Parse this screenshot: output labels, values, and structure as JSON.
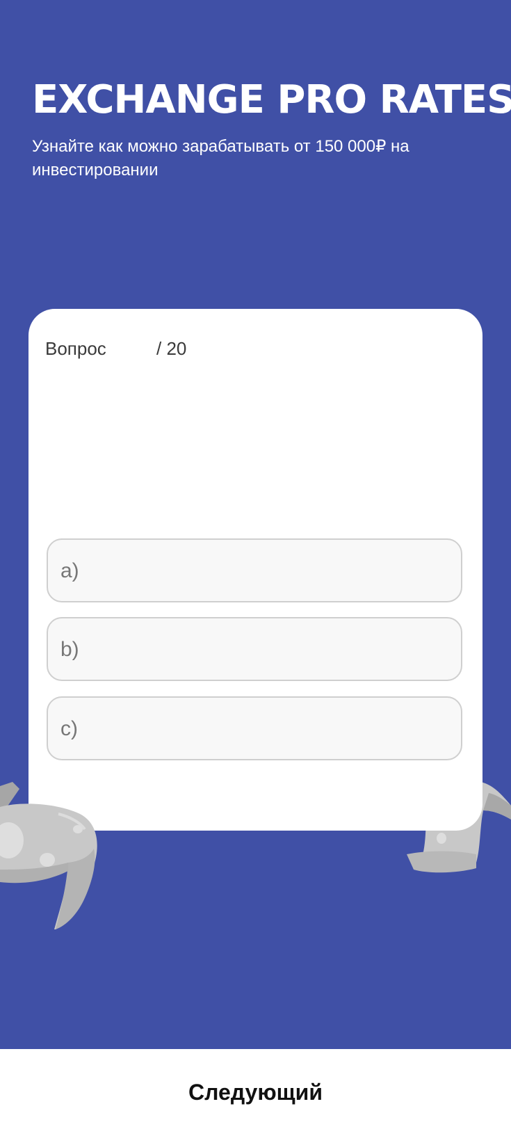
{
  "header": {
    "title": "EXCHANGE PRO RATES",
    "subtitle": "Узнайте как можно зарабатывать от 150 000₽ на инвестировании"
  },
  "quiz": {
    "question_label": "Вопрос",
    "question_number": "",
    "question_total": "/ 20",
    "question_text": "",
    "options": [
      {
        "label": "a)",
        "text": ""
      },
      {
        "label": "b)",
        "text": ""
      },
      {
        "label": "c)",
        "text": ""
      }
    ]
  },
  "footer": {
    "next_label": "Следующий"
  },
  "colors": {
    "background": "#4050a6",
    "card": "#ffffff",
    "option_bg": "#f8f8f8",
    "option_border": "#cfcfcf"
  },
  "icons": {
    "left_decoration": "paper-scroll-icon",
    "right_decoration": "paper-scroll-icon"
  }
}
